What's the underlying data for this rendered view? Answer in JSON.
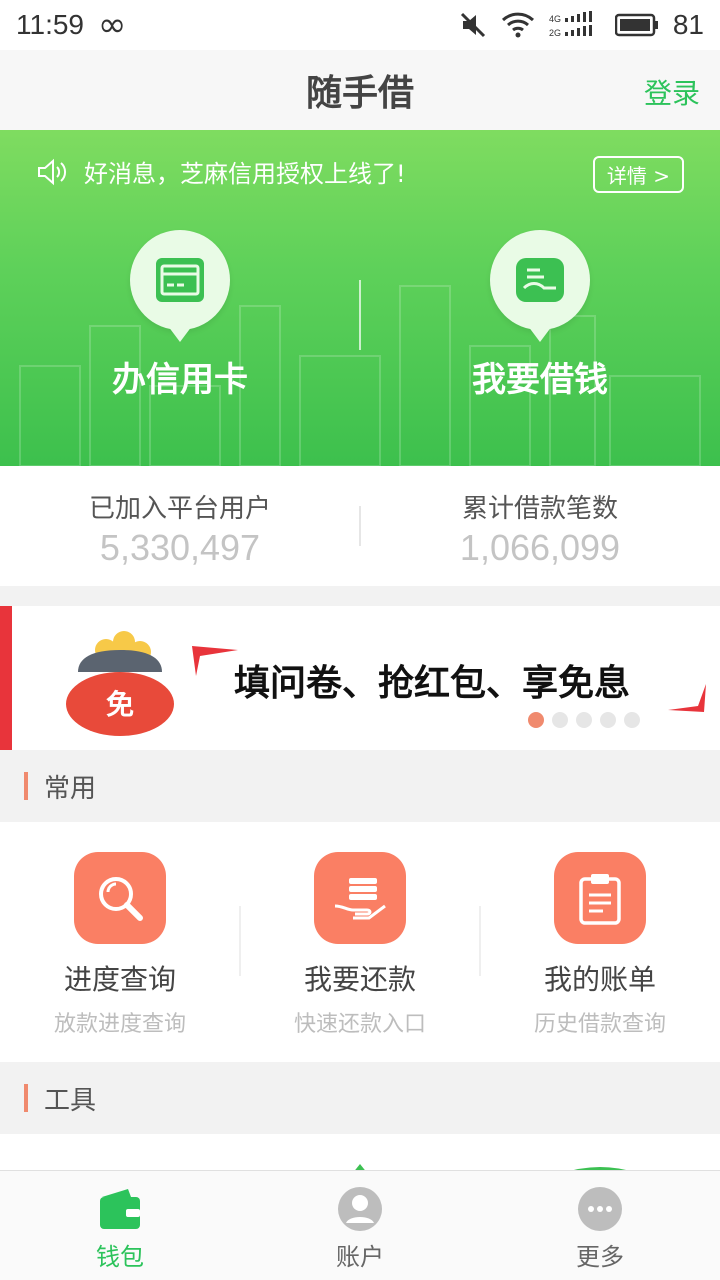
{
  "status": {
    "time": "11:59",
    "infinity": "∞",
    "battery": "81",
    "network": "4G 2G"
  },
  "header": {
    "title": "随手借",
    "login": "登录"
  },
  "notice": {
    "text": "好消息，芝麻信用授权上线了!",
    "detail": "详情 >"
  },
  "hero": {
    "left_label": "办信用卡",
    "right_label": "我要借钱"
  },
  "stats": [
    {
      "label": "已加入平台用户",
      "value": "5,330,497"
    },
    {
      "label": "累计借款笔数",
      "value": "1,066,099"
    }
  ],
  "banner": {
    "text": "填问卷、抢红包、享免息",
    "badge": "免",
    "slides": 5,
    "active_slide": 1
  },
  "sections": {
    "common": "常用",
    "tools": "工具"
  },
  "common_items": [
    {
      "label": "进度查询",
      "sub": "放款进度查询"
    },
    {
      "label": "我要还款",
      "sub": "快速还款入口"
    },
    {
      "label": "我的账单",
      "sub": "历史借款查询"
    }
  ],
  "nav": [
    {
      "label": "钱包",
      "icon": "wallet-icon",
      "active": true
    },
    {
      "label": "账户",
      "icon": "user-icon",
      "active": false
    },
    {
      "label": "更多",
      "icon": "more-icon",
      "active": false
    }
  ],
  "colors": {
    "accent": "#2cc35b",
    "orange": "#fa7f64",
    "hero_top": "#7fdc60",
    "hero_bottom": "#3dc04d"
  }
}
